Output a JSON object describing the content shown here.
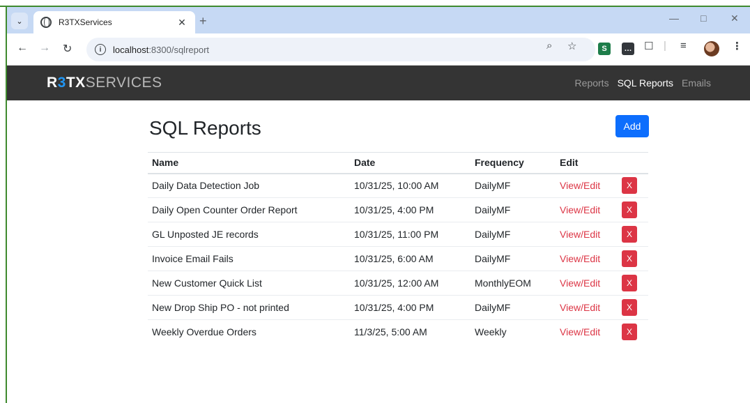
{
  "browser": {
    "tab_title": "R3TXServices",
    "url_host": "localhost",
    "url_rest": ":8300/sqlreport"
  },
  "app": {
    "brand_r": "R",
    "brand_3": "3",
    "brand_tx": "TX",
    "brand_services": "SERVICES",
    "nav": [
      "Reports",
      "SQL Reports",
      "Emails"
    ],
    "active_nav": "SQL Reports"
  },
  "page": {
    "title": "SQL Reports",
    "add_label": "Add"
  },
  "table": {
    "headers": [
      "Name",
      "Date",
      "Frequency",
      "Edit"
    ],
    "rows": [
      {
        "name": "Daily Data Detection Job",
        "date": "10/31/25, 10:00 AM",
        "frequency": "DailyMF",
        "edit": "View/Edit",
        "delete": "X"
      },
      {
        "name": "Daily Open Counter Order Report",
        "date": "10/31/25, 4:00 PM",
        "frequency": "DailyMF",
        "edit": "View/Edit",
        "delete": "X"
      },
      {
        "name": "GL Unposted JE records",
        "date": "10/31/25, 11:00 PM",
        "frequency": "DailyMF",
        "edit": "View/Edit",
        "delete": "X"
      },
      {
        "name": "Invoice Email Fails",
        "date": "10/31/25, 6:00 AM",
        "frequency": "DailyMF",
        "edit": "View/Edit",
        "delete": "X"
      },
      {
        "name": "New Customer Quick List",
        "date": "10/31/25, 12:00 AM",
        "frequency": "MonthlyEOM",
        "edit": "View/Edit",
        "delete": "X"
      },
      {
        "name": "New Drop Ship PO - not printed",
        "date": "10/31/25, 4:00 PM",
        "frequency": "DailyMF",
        "edit": "View/Edit",
        "delete": "X"
      },
      {
        "name": "Weekly Overdue Orders",
        "date": "11/3/25, 5:00 AM",
        "frequency": "Weekly",
        "edit": "View/Edit",
        "delete": "X"
      }
    ]
  },
  "colors": {
    "accent": "#0d6efd",
    "danger": "#dc3545",
    "navbar": "#343434",
    "frame": "#3f8a2e"
  }
}
